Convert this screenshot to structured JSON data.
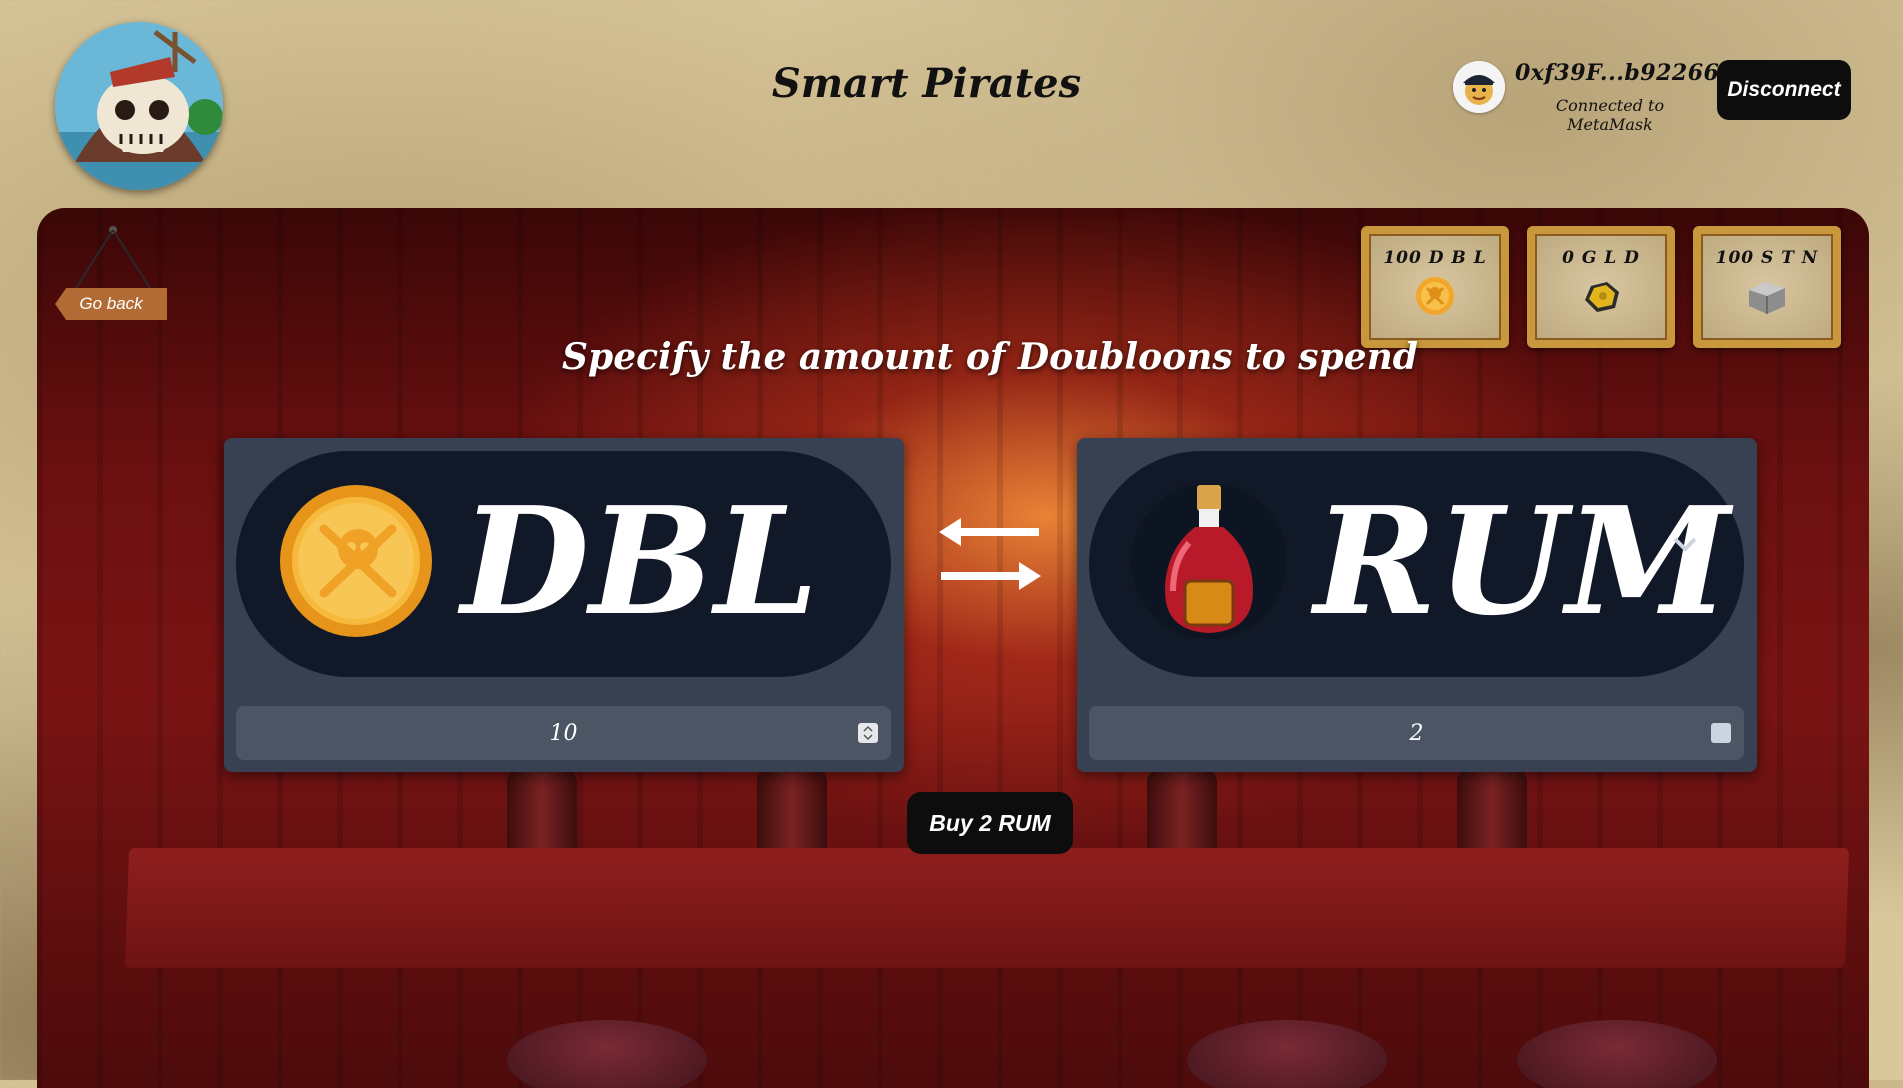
{
  "header": {
    "title": "Smart Pirates",
    "logo_icon": "skull-island-logo",
    "user": {
      "address": "0xf39F...b92266",
      "provider": "Connected to MetaMask",
      "avatar_icon": "pirate-avatar-icon"
    },
    "disconnect_label": "Disconnect"
  },
  "nav": {
    "go_back_label": "Go back"
  },
  "balances": [
    {
      "label": "100 D B L",
      "icon": "doubloon-coin-icon"
    },
    {
      "label": "0 G L D",
      "icon": "gold-nugget-icon"
    },
    {
      "label": "100 S T N",
      "icon": "stone-block-icon"
    }
  ],
  "exchange": {
    "instruction": "Specify the amount of Doubloons to spend",
    "from": {
      "token": "DBL",
      "icon": "doubloon-coin-icon",
      "amount": "10"
    },
    "to": {
      "token": "RUM",
      "icon": "rum-bottle-icon",
      "amount": "2"
    },
    "buy_label": "Buy 2 RUM"
  },
  "colors": {
    "card_bg": "#374151",
    "pill_bg": "#111827",
    "field_bg": "#4b5563",
    "button_bg": "#0d0d0d",
    "frame_gold": "#c9973c"
  }
}
